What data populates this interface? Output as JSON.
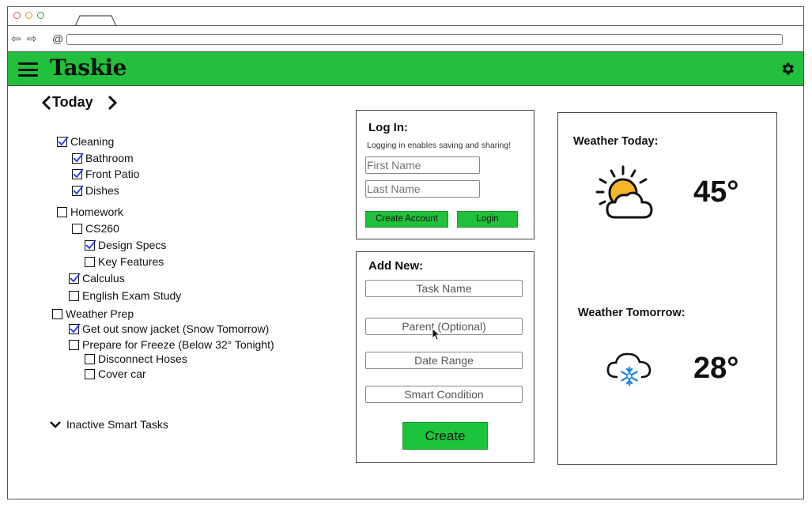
{
  "app": {
    "title": "Taskie"
  },
  "colors": {
    "brand_green": "#22c03c",
    "check_blue": "#2233ee",
    "sun_yellow": "#f5b62a",
    "snow_blue": "#1e88e5"
  },
  "icons": [
    "menu-icon",
    "gear-icon",
    "chevron-left-icon",
    "chevron-right-icon",
    "chevron-down-icon",
    "checkbox-icon",
    "sun-cloud-icon",
    "snow-cloud-icon"
  ],
  "tasks": {
    "day_label": "Today",
    "items": [
      {
        "label": "Cleaning",
        "checked": true
      },
      {
        "label": "Bathroom",
        "checked": true
      },
      {
        "label": "Front Patio",
        "checked": true
      },
      {
        "label": "Dishes",
        "checked": true
      },
      {
        "label": "Homework",
        "checked": false
      },
      {
        "label": "CS260",
        "checked": false
      },
      {
        "label": "Design Specs",
        "checked": true
      },
      {
        "label": "Key Features",
        "checked": false
      },
      {
        "label": "Calculus",
        "checked": true
      },
      {
        "label": "English Exam Study",
        "checked": false
      },
      {
        "label": "Weather Prep",
        "checked": false
      },
      {
        "label": "Get out snow jacket  (Snow Tomorrow)",
        "checked": true
      },
      {
        "label": "Prepare for Freeze  (Below 32° Tonight)",
        "checked": false
      },
      {
        "label": "Disconnect Hoses",
        "checked": false
      },
      {
        "label": "Cover car",
        "checked": false
      }
    ],
    "inactive_label": "Inactive Smart Tasks"
  },
  "login": {
    "title": "Log In:",
    "note": "Logging in enables saving and sharing!",
    "first_name_placeholder": "First Name",
    "last_name_placeholder": "Last Name",
    "create_account_label": "Create Account",
    "login_label": "Login"
  },
  "add_new": {
    "title": "Add New:",
    "task_name_placeholder": "Task Name",
    "parent_placeholder": "Parent (Optional)",
    "date_range_placeholder": "Date Range",
    "smart_condition_placeholder": "Smart Condition",
    "create_label": "Create"
  },
  "weather": {
    "today_label": "Weather Today:",
    "today_temp": "45°",
    "tomorrow_label": "Weather Tomorrow:",
    "tomorrow_temp": "28°"
  }
}
